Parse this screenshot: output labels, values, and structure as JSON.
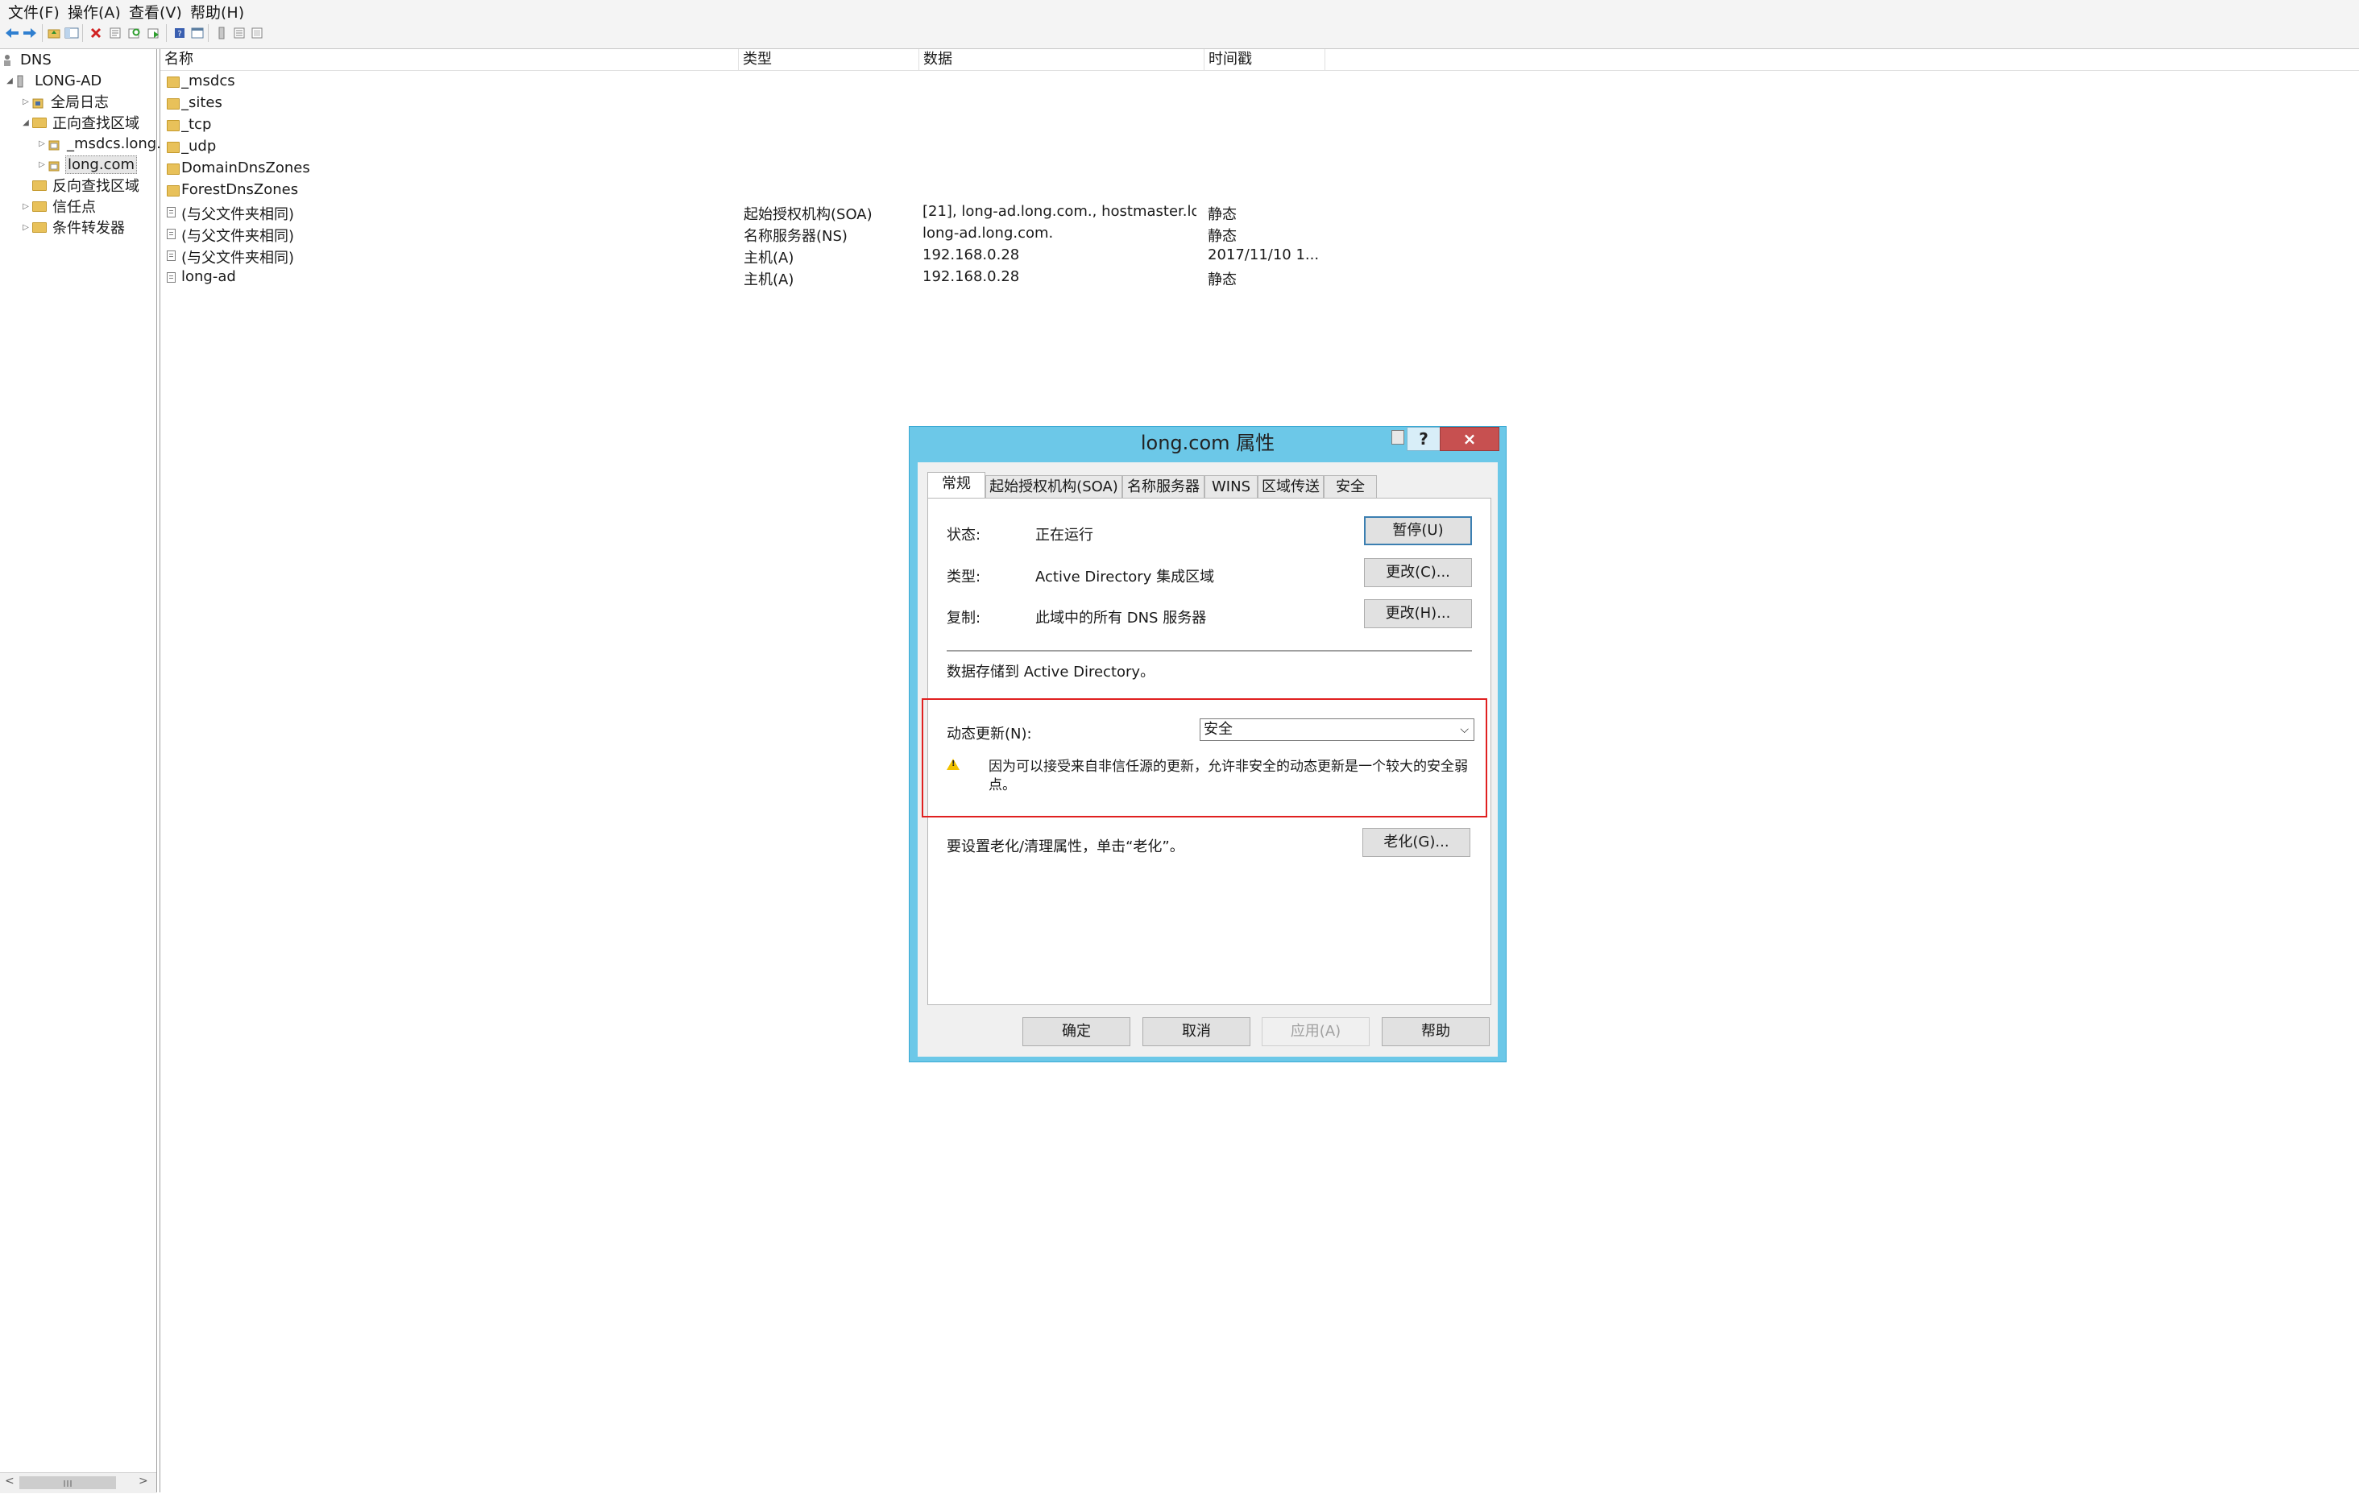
{
  "menu": {
    "file": "文件(F)",
    "action": "操作(A)",
    "view": "查看(V)",
    "help": "帮助(H)"
  },
  "toolbar": {
    "icons": [
      "back-icon",
      "forward-icon",
      "up-folder-icon",
      "show-hide-tree-icon",
      "delete-icon",
      "properties-icon",
      "refresh-icon",
      "export-icon",
      "help-icon",
      "console-icon",
      "server-icon",
      "list-icon",
      "details-icon"
    ]
  },
  "tree": {
    "root": "DNS",
    "server": "LONG-AD",
    "global_logs": "全局日志",
    "forward_zones": "正向查找区域",
    "msdcs_zone": "_msdcs.long.",
    "long_zone": "long.com",
    "reverse_zones": "反向查找区域",
    "trust_points": "信任点",
    "conditional_forwarders": "条件转发器"
  },
  "list": {
    "columns": {
      "name": "名称",
      "type": "类型",
      "data": "数据",
      "timestamp": "时间戳"
    },
    "rows": [
      {
        "name": "_msdcs",
        "type": "",
        "data": "",
        "timestamp": "",
        "icon": "folder"
      },
      {
        "name": "_sites",
        "type": "",
        "data": "",
        "timestamp": "",
        "icon": "folder"
      },
      {
        "name": "_tcp",
        "type": "",
        "data": "",
        "timestamp": "",
        "icon": "folder"
      },
      {
        "name": "_udp",
        "type": "",
        "data": "",
        "timestamp": "",
        "icon": "folder"
      },
      {
        "name": "DomainDnsZones",
        "type": "",
        "data": "",
        "timestamp": "",
        "icon": "folder"
      },
      {
        "name": "ForestDnsZones",
        "type": "",
        "data": "",
        "timestamp": "",
        "icon": "folder"
      },
      {
        "name": "(与父文件夹相同)",
        "type": "起始授权机构(SOA)",
        "data": "[21], long-ad.long.com., hostmaster.lo...",
        "timestamp": "静态",
        "icon": "record"
      },
      {
        "name": "(与父文件夹相同)",
        "type": "名称服务器(NS)",
        "data": "long-ad.long.com.",
        "timestamp": "静态",
        "icon": "record"
      },
      {
        "name": "(与父文件夹相同)",
        "type": "主机(A)",
        "data": "192.168.0.28",
        "timestamp": "2017/11/10 1...",
        "icon": "record"
      },
      {
        "name": "long-ad",
        "type": "主机(A)",
        "data": "192.168.0.28",
        "timestamp": "静态",
        "icon": "record"
      }
    ]
  },
  "dialog": {
    "title": "long.com 属性",
    "help_btn": "?",
    "close_btn": "×",
    "tabs": [
      "常规",
      "起始授权机构(SOA)",
      "名称服务器",
      "WINS",
      "区域传送",
      "安全"
    ],
    "status_label": "状态:",
    "status_value": "正在运行",
    "pause_btn": "暂停(U)",
    "type_label": "类型:",
    "type_value": "Active Directory 集成区域",
    "change_type_btn": "更改(C)...",
    "replication_label": "复制:",
    "replication_value": "此域中的所有 DNS 服务器",
    "change_repl_btn": "更改(H)...",
    "storage_text": "数据存储到 Active Directory。",
    "dynamic_update_label": "动态更新(N):",
    "dynamic_update_value": "安全",
    "warning_text": "因为可以接受来自非信任源的更新，允许非安全的动态更新是一个较大的安全弱点。",
    "aging_text": "要设置老化/清理属性，单击“老化”。",
    "aging_btn": "老化(G)...",
    "ok_btn": "确定",
    "cancel_btn": "取消",
    "apply_btn": "应用(A)",
    "help_footer_btn": "帮助"
  }
}
